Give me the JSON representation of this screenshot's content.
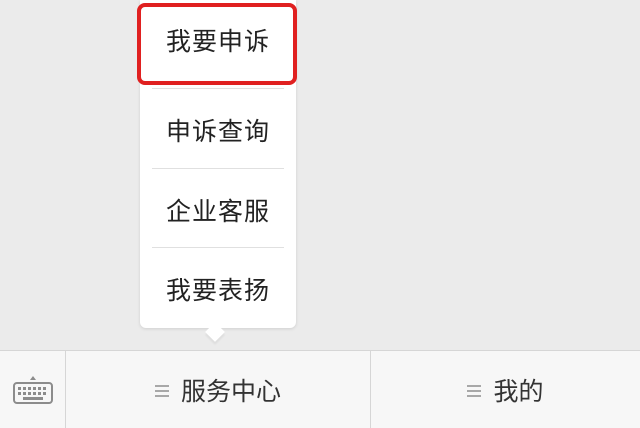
{
  "popup_menu": {
    "items": [
      {
        "label": "我要申诉",
        "highlighted": true
      },
      {
        "label": "申诉查询",
        "highlighted": false
      },
      {
        "label": "企业客服",
        "highlighted": false
      },
      {
        "label": "我要表扬",
        "highlighted": false
      }
    ],
    "highlight_color": "#e02020"
  },
  "bottom_bar": {
    "keyboard_icon": "keyboard-icon",
    "tabs": [
      {
        "label": "服务中心",
        "icon": "menu-lines-icon"
      },
      {
        "label": "我的",
        "icon": "menu-lines-icon"
      }
    ]
  }
}
